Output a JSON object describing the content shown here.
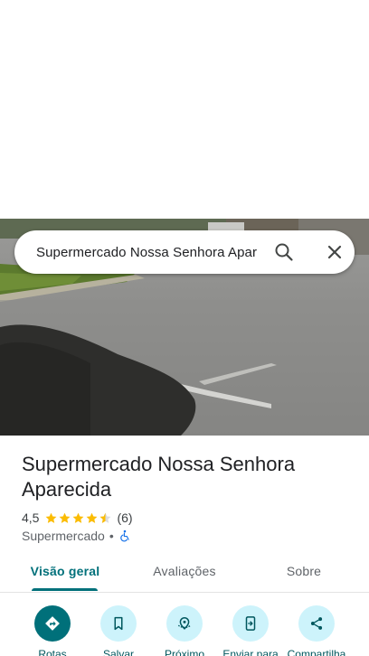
{
  "search": {
    "query": "Supermercado Nossa Senhora Apar"
  },
  "place": {
    "title": "Supermercado Nossa Senhora Aparecida",
    "rating": "4,5",
    "rating_stars": 4.5,
    "review_count": "(6)",
    "category": "Supermercado",
    "separator": "•",
    "accessible": true
  },
  "tabs": [
    {
      "label": "Visão geral",
      "active": true
    },
    {
      "label": "Avaliações",
      "active": false
    },
    {
      "label": "Sobre",
      "active": false
    }
  ],
  "actions": [
    {
      "label": "Rotas",
      "icon": "directions-icon"
    },
    {
      "label": "Salvar",
      "icon": "bookmark-icon"
    },
    {
      "label": "Próximo",
      "icon": "nearby-icon"
    },
    {
      "label": "Enviar para",
      "icon": "send-to-phone-icon"
    },
    {
      "label": "Compartilha",
      "icon": "share-icon"
    }
  ],
  "colors": {
    "accent": "#00707a",
    "action_bg": "#cdf3fb",
    "star": "#fbbc04",
    "accessibility": "#1a73e8"
  }
}
